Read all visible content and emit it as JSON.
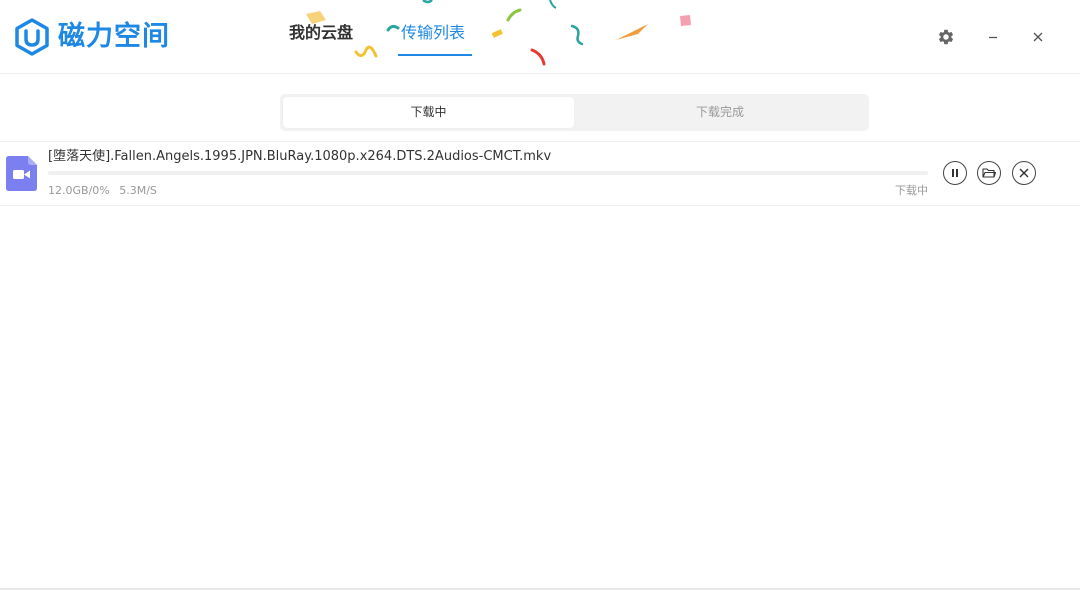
{
  "app": {
    "name": "磁力空间",
    "brand_color": "#1e88e5"
  },
  "nav": {
    "tabs": [
      {
        "label": "我的云盘",
        "active": false
      },
      {
        "label": "传输列表",
        "active": true
      }
    ]
  },
  "window_controls": {
    "settings_icon": "gear-icon",
    "minimize_label": "–",
    "close_label": "×"
  },
  "segments": [
    {
      "label": "下载中",
      "active": true
    },
    {
      "label": "下载完成",
      "active": false
    }
  ],
  "downloads": [
    {
      "file_icon": "video-file-icon",
      "icon_color": "#7b7ff0",
      "name": "[堕落天使].Fallen.Angels.1995.JPN.BluRay.1080p.x264.DTS.2Audios-CMCT.mkv",
      "size_progress": "12.0GB/0%",
      "speed": "5.3M/S",
      "progress_percent": 0,
      "status": "下载中",
      "actions": [
        "pause-icon",
        "folder-icon",
        "close-icon"
      ]
    }
  ]
}
